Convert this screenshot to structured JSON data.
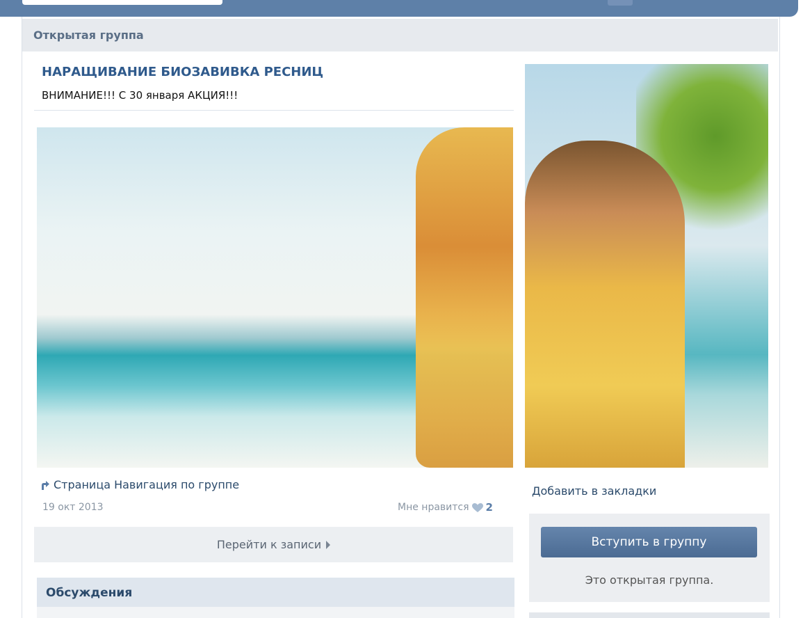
{
  "header": {
    "label": "Открытая группа"
  },
  "group": {
    "title": "НАРАЩИВАНИЕ БИОЗАВИВКА РЕСНИЦ",
    "status": "ВНИМАНИЕ!!! С 30 января АКЦИЯ!!!"
  },
  "post": {
    "link_text": "Страница Навигация по группе",
    "date": "19 окт 2013",
    "likes_label": "Мне нравится",
    "likes_count": "2",
    "goto_label": "Перейти к записи"
  },
  "discussions": {
    "title": "Обсуждения"
  },
  "sidebar": {
    "bookmark_label": "Добавить в закладки",
    "join_label": "Вступить в группу",
    "join_note": "Это открытая группа."
  },
  "icons": {
    "link": "link-arrow-icon",
    "heart": "heart-icon",
    "goto": "chevron-right-icon"
  },
  "colors": {
    "topbar": "#5e80a8",
    "link": "#2b4a6b",
    "title": "#2f5a8c",
    "button": "#4b6b93"
  }
}
